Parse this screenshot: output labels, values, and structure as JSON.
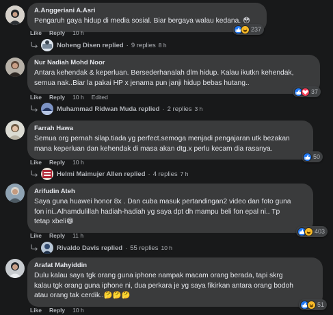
{
  "comments": [
    {
      "author": "A.Anggeriani A.Asri",
      "text": "Pengaruh gaya hidup di media sosial. Biar bergaya walau kedana. 😳",
      "like": "Like",
      "reply": "Reply",
      "time": "10 h",
      "edited": "",
      "reactions": {
        "icons": [
          "like-icon",
          "haha-icon"
        ],
        "count": "237"
      },
      "replies": {
        "name": "Noheng Disen replied",
        "sep": "·",
        "count": "9 replies",
        "time": "8 h"
      }
    },
    {
      "author": "Nur Nadiah Mohd Noor",
      "text": "Antara kehendak & keperluan. Bersederhanalah dlm hidup. Kalau ikutkn kehendak,\nsemua nak..Biar la pakai HP x jenama pun janji hidup bebas hutang..",
      "like": "Like",
      "reply": "Reply",
      "time": "10 h",
      "edited": "Edited",
      "reactions": {
        "icons": [
          "like-icon",
          "love-icon"
        ],
        "count": "37"
      },
      "replies": {
        "name": "Muhammad Ridwan Muda replied",
        "sep": "·",
        "count": "2 replies",
        "time": "3 h"
      }
    },
    {
      "author": "Farrah Hawa",
      "text": "Semua org pernah silap.tiada yg perfect.semoga menjadi pengajaran utk bezakan\nmana keperluan dan kehendak di masa akan dtg.x perlu kecam dia rasanya.",
      "like": "Like",
      "reply": "Reply",
      "time": "10 h",
      "edited": "",
      "reactions": {
        "icons": [
          "like-icon"
        ],
        "count": "50"
      },
      "replies": {
        "name": "Helmi Maimujer Allen replied",
        "sep": "·",
        "count": "4 replies",
        "time": "7 h"
      }
    },
    {
      "author": "Arifudin Ateh",
      "text": "Saya guna huawei honor 8x . Dan cuba masuk pertandingan2 video dan foto guna\nfon ini..Alhamdulillah hadiah-hadiah yg saya dpt dh mampu beli fon epal ni.. Tp\ntetap xbeli😁",
      "like": "Like",
      "reply": "Reply",
      "time": "11 h",
      "edited": "",
      "reactions": {
        "icons": [
          "like-icon",
          "haha-icon"
        ],
        "count": "403"
      },
      "replies": {
        "name": "Rivaldo Davis replied",
        "sep": "·",
        "count": "55 replies",
        "time": "10 h"
      }
    },
    {
      "author": "Arafat Mahyiddin",
      "text": "Dulu kalau saya tgk orang guna iphone nampak macam orang berada, tapi skrg\nkalau tgk orang guna iphone ni, dua perkara je yg saya fikirkan antara orang bodoh\natau orang tak cerdik..🤔🤔🤔",
      "like": "Like",
      "reply": "Reply",
      "time": "10 h",
      "edited": "",
      "reactions": {
        "icons": [
          "like-icon",
          "haha-icon"
        ],
        "count": "51"
      },
      "replies": null
    }
  ],
  "colors": {
    "background": "#18191a",
    "bubble": "#3a3b3c",
    "like_blue": "#2078f4",
    "love_red": "#f33e58",
    "haha_yellow": "#f7b928",
    "text": "#e4e6eb",
    "muted": "#b0b3b8"
  }
}
